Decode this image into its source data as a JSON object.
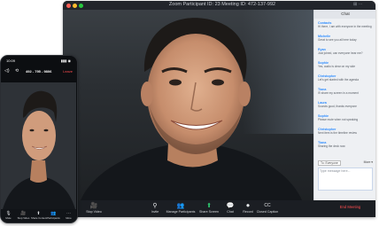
{
  "window": {
    "title": "Zoom Participant ID: 23     Meeting ID: 472-137-992",
    "controls": "⊞ ⋯"
  },
  "chat": {
    "header": "Chat",
    "messages": [
      {
        "name": "Contacts",
        "text": "Hi there, I am with everyone in the meeting"
      },
      {
        "name": "Michelle",
        "text": "Great to see you all here today"
      },
      {
        "name": "Ryan",
        "text": "Just joined, can everyone hear me?"
      },
      {
        "name": "Sophie",
        "text": "Yes, audio is clear on my side"
      },
      {
        "name": "Christopher",
        "text": "Let's get started with the agenda"
      },
      {
        "name": "Tiana",
        "text": "I'll share my screen in a moment"
      },
      {
        "name": "Laura",
        "text": "Sounds good, thanks everyone"
      },
      {
        "name": "Sophie",
        "text": "Please mute when not speaking"
      },
      {
        "name": "Christopher",
        "text": "Next item is the timeline review"
      },
      {
        "name": "Tiana",
        "text": "Sharing the deck now"
      }
    ],
    "to_label": "To: Everyone",
    "more_label": "More ▾",
    "input_placeholder": "Type message here..."
  },
  "toolbar": {
    "items": [
      {
        "icon": "🎥",
        "label": "Stop Video"
      },
      {
        "icon": "⚲",
        "label": "Invite"
      },
      {
        "icon": "👥",
        "label": "Manage Participants"
      },
      {
        "icon": "⬆",
        "label": "Share Screen"
      },
      {
        "icon": "💬",
        "label": "Chat"
      },
      {
        "icon": "⏺",
        "label": "Record"
      },
      {
        "icon": "CC",
        "label": "Closed Caption"
      }
    ],
    "end_label": "End Meeting"
  },
  "phone": {
    "time": "10:09",
    "status_icons": "▮▮▮ ◉",
    "meeting_id": "492 - 795 - 9806",
    "leave_label": "Leave",
    "toolbar": [
      {
        "icon": "🎙",
        "label": "Mute"
      },
      {
        "icon": "🎥",
        "label": "Stop Video"
      },
      {
        "icon": "⬆",
        "label": "Share Content"
      },
      {
        "icon": "👥",
        "label": "Participants"
      },
      {
        "icon": "⋯",
        "label": "More"
      }
    ]
  },
  "colors": {
    "accent": "#2d8cff",
    "end_meeting": "#ff4d4f",
    "toolbar_bg": "#1b1e23",
    "chat_bg": "#eef0f3"
  }
}
